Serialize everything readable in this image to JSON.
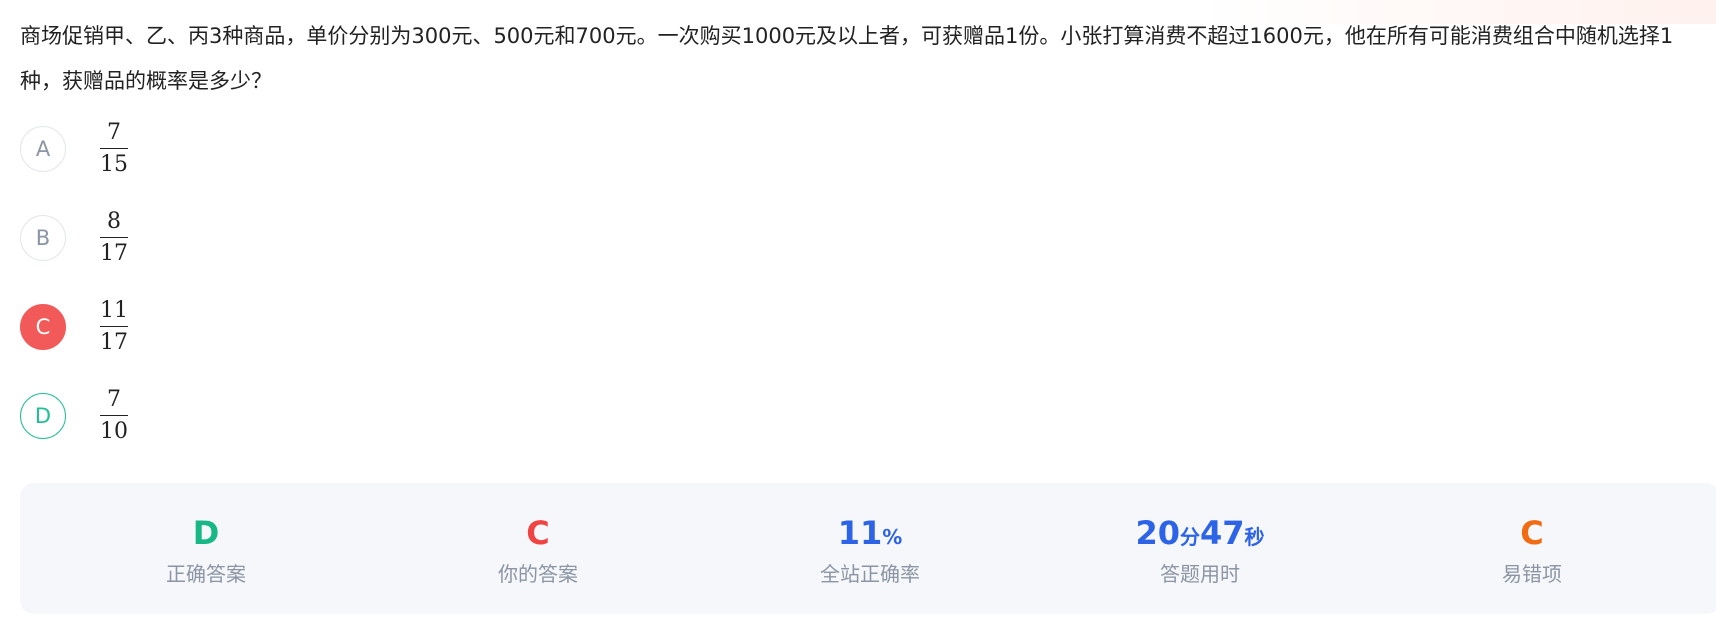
{
  "question": {
    "text": "商场促销甲、乙、丙3种商品，单价分别为300元、500元和700元。一次购买1000元及以上者，可获赠品1份。小张打算消费不超过1600元，他在所有可能消费组合中随机选择1种，获赠品的概率是多少？"
  },
  "options": [
    {
      "letter": "A",
      "numerator": "7",
      "denominator": "15"
    },
    {
      "letter": "B",
      "numerator": "8",
      "denominator": "17"
    },
    {
      "letter": "C",
      "numerator": "11",
      "denominator": "17"
    },
    {
      "letter": "D",
      "numerator": "7",
      "denominator": "10"
    }
  ],
  "stats": {
    "correct_answer": {
      "value": "D",
      "label": "正确答案"
    },
    "your_answer": {
      "value": "C",
      "label": "你的答案"
    },
    "site_accuracy": {
      "value": "11",
      "unit": "%",
      "label": "全站正确率"
    },
    "time_used": {
      "minutes": "20",
      "minutes_unit": "分",
      "seconds": "47",
      "seconds_unit": "秒",
      "label": "答题用时"
    },
    "common_wrong": {
      "value": "C",
      "label": "易错项"
    }
  },
  "colors": {
    "correct": "#17b883",
    "wrong": "#f04444",
    "accent": "#2d63e6",
    "warning": "#f26a12"
  }
}
